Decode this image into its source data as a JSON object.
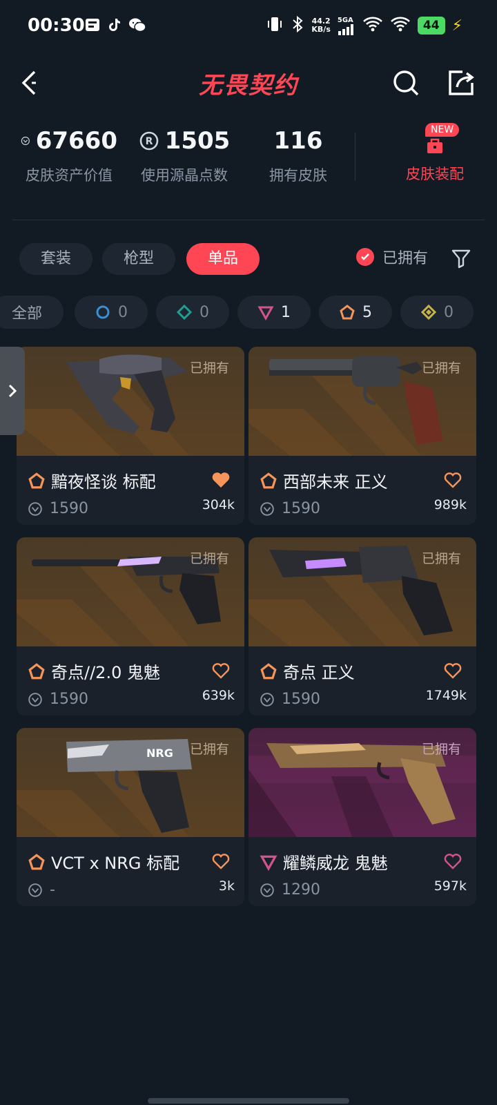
{
  "status_bar": {
    "time": "00:30",
    "speed_value": "44.2",
    "speed_unit": "KB/s",
    "network": "5GA",
    "battery": "44"
  },
  "header": {
    "title": "无畏契约"
  },
  "stats": {
    "asset_value": "67660",
    "asset_label": "皮肤资产价值",
    "radianite_used": "1505",
    "radianite_label": "使用源晶点数",
    "skins_owned": "116",
    "skins_label": "拥有皮肤",
    "outfit_label": "皮肤装配",
    "new_badge": "NEW"
  },
  "tabs": [
    {
      "label": "套装",
      "active": false
    },
    {
      "label": "枪型",
      "active": false
    },
    {
      "label": "单品",
      "active": true
    }
  ],
  "owned_filter_label": "已拥有",
  "tier_chips": [
    {
      "label": "全部"
    },
    {
      "tier": "select",
      "count": "0",
      "color": "#3b8fd4"
    },
    {
      "tier": "deluxe",
      "count": "0",
      "color": "#1f9e94"
    },
    {
      "tier": "premium",
      "count": "1",
      "color": "#d1548e"
    },
    {
      "tier": "exclusive",
      "count": "5",
      "color": "#f5955b"
    },
    {
      "tier": "ultra",
      "count": "0",
      "color": "#c9b44a"
    }
  ],
  "cards": [
    {
      "name": "黯夜怪谈 标配",
      "price": "1590",
      "likes": "304k",
      "owned_tag": "已拥有",
      "tier": "exclusive",
      "liked": true
    },
    {
      "name": "西部未来 正义",
      "price": "1590",
      "likes": "989k",
      "owned_tag": "已拥有",
      "tier": "exclusive",
      "liked": false
    },
    {
      "name": "奇点//2.0 鬼魅",
      "price": "1590",
      "likes": "639k",
      "owned_tag": "已拥有",
      "tier": "exclusive",
      "liked": false
    },
    {
      "name": "奇点 正义",
      "price": "1590",
      "likes": "1749k",
      "owned_tag": "已拥有",
      "tier": "exclusive",
      "liked": false
    },
    {
      "name": "VCT x NRG 标配",
      "price": "-",
      "likes": "3k",
      "owned_tag": "已拥有",
      "tier": "exclusive",
      "liked": false
    },
    {
      "name": "耀鳞威龙 鬼魅",
      "price": "1290",
      "likes": "597k",
      "owned_tag": "已拥有",
      "tier": "premium",
      "liked": false
    }
  ],
  "colors": {
    "accent": "#ff4655",
    "exclusive_tier": "#f5955b",
    "premium_tier": "#d1548e"
  }
}
